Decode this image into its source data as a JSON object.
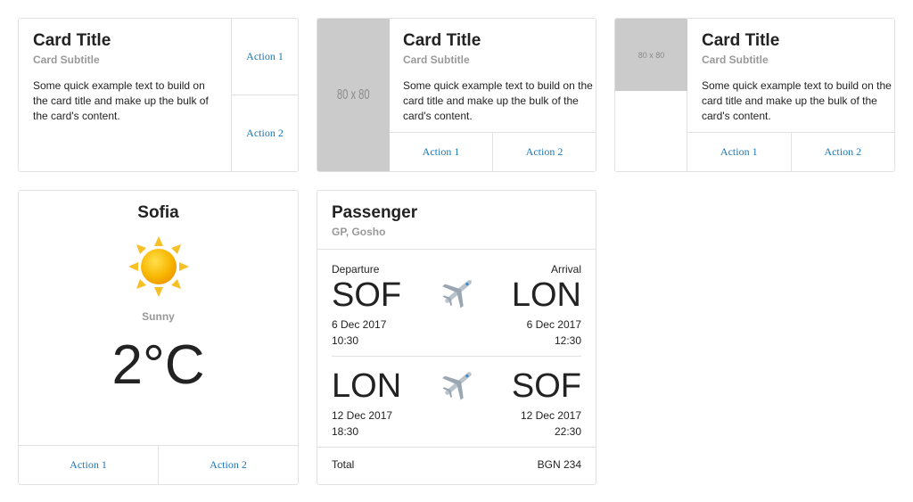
{
  "cards": [
    {
      "title": "Card Title",
      "subtitle": "Card Subtitle",
      "text": "Some quick example text to build on the card title and make up the bulk of the card's content.",
      "actions": [
        "Action 1",
        "Action 2"
      ]
    },
    {
      "title": "Card Title",
      "subtitle": "Card Subtitle",
      "text": "Some quick example text to build on the card title and make up the bulk of the card's content.",
      "image_label": "80 x 80",
      "actions": [
        "Action 1",
        "Action 2"
      ]
    },
    {
      "title": "Card Title",
      "subtitle": "Card Subtitle",
      "text": "Some quick example text to build on the card title and make up the bulk of the card's content.",
      "image_label": "80 x 80",
      "actions": [
        "Action 1",
        "Action 2"
      ]
    }
  ],
  "weather": {
    "city": "Sofia",
    "icon": "sun-icon",
    "condition": "Sunny",
    "temperature": "2°C",
    "actions": [
      "Action 1",
      "Action 2"
    ]
  },
  "flight": {
    "title": "Passenger",
    "passenger": "GP, Gosho",
    "departure_label": "Departure",
    "arrival_label": "Arrival",
    "legs": [
      {
        "from": "SOF",
        "to": "LON",
        "dep_date": "6 Dec 2017",
        "dep_time": "10:30",
        "arr_date": "6 Dec 2017",
        "arr_time": "12:30"
      },
      {
        "from": "LON",
        "to": "SOF",
        "dep_date": "12 Dec 2017",
        "dep_time": "18:30",
        "arr_date": "12 Dec 2017",
        "arr_time": "22:30"
      }
    ],
    "plane_icon": "airplane-icon",
    "total_label": "Total",
    "total_value": "BGN 234"
  },
  "colors": {
    "link": "#1a78b8",
    "border": "#e2e2e2",
    "placeholder": "#cbcbcb",
    "sun": "#f7b500"
  }
}
